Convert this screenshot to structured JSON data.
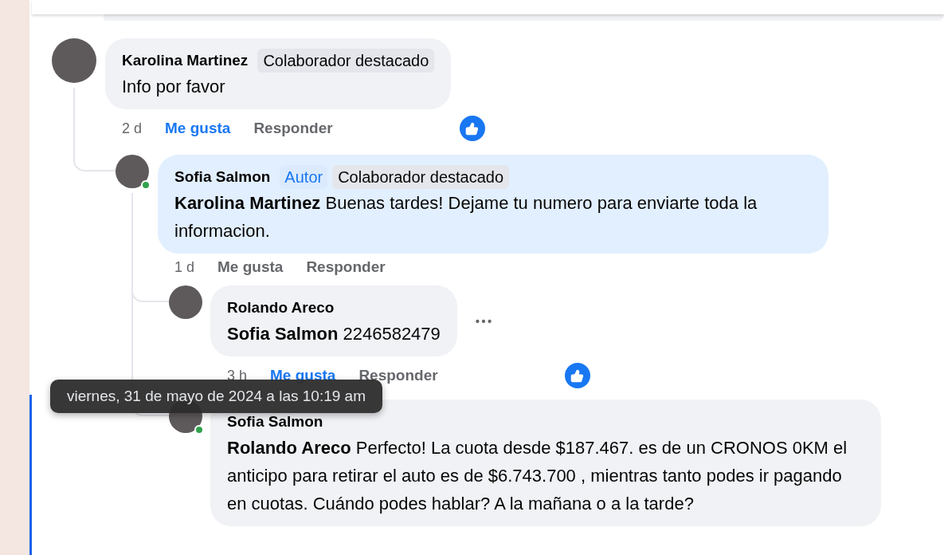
{
  "comments": [
    {
      "author": "Karolina Martinez",
      "badges": [
        {
          "kind": "featured",
          "label": "Colaborador destacado"
        }
      ],
      "text": "Info por favor",
      "time": "2 d",
      "like_label": "Me gusta",
      "liked": true,
      "reply_label": "Responder",
      "reaction": true,
      "online": false,
      "highlighted": false,
      "more_menu": false,
      "children": [
        {
          "author": "Sofia Salmon",
          "badges": [
            {
              "kind": "author",
              "label": "Autor"
            },
            {
              "kind": "featured",
              "label": "Colaborador destacado"
            }
          ],
          "text": "**Karolina Martinez** Buenas tardes! Dejame tu numero para enviarte toda la informacion.",
          "time": "1 d",
          "like_label": "Me gusta",
          "liked": false,
          "reply_label": "Responder",
          "reaction": false,
          "online": true,
          "highlighted": true,
          "more_menu": false,
          "children": [
            {
              "author": "Rolando Areco",
              "text": "**Sofia Salmon** 2246582479",
              "time": "3 h",
              "like_label": "Me gusta",
              "liked": true,
              "reply_label": "Responder",
              "reaction": true,
              "online": false,
              "highlighted": false,
              "more_menu": true
            },
            {
              "author": "Sofia Salmon",
              "text": "**Rolando Areco** Perfecto! La cuota desde $187.467. es de un CRONOS 0KM el anticipo para retirar el auto es de $6.743.700 , mientras tanto podes ir pagando en cuotas. Cuándo podes hablar? A la mañana o a la tarde?",
              "online": true,
              "highlighted": false,
              "more_menu": false
            }
          ]
        }
      ]
    }
  ],
  "tooltip": {
    "text": "viernes, 31 de mayo de 2024 a las 10:19 am"
  }
}
